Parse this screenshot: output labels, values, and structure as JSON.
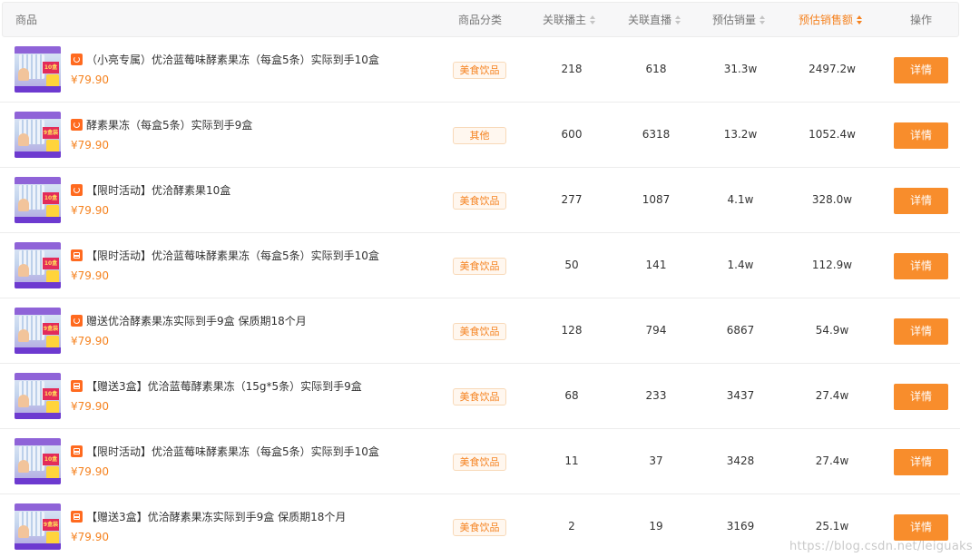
{
  "header": {
    "product": "商品",
    "category": "商品分类",
    "anchors": "关联播主",
    "lives": "关联直播",
    "sales": "预估销量",
    "revenue": "预估销售额",
    "actions": "操作"
  },
  "accent_color": "#f5821f",
  "rows": [
    {
      "icon": "tmall-icon",
      "title": "（小亮专属）优洽蓝莓味酵素果冻（每盒5条）实际到手10盒",
      "price": "¥79.90",
      "category": "美食饮品",
      "anchors": "218",
      "lives": "618",
      "sales": "31.3w",
      "revenue": "2497.2w",
      "action": "详情",
      "thumb_badge": "10盒装"
    },
    {
      "icon": "tmall-icon",
      "title": "酵素果冻（每盒5条）实际到手9盒",
      "price": "¥79.90",
      "category": "其他",
      "anchors": "600",
      "lives": "6318",
      "sales": "13.2w",
      "revenue": "1052.4w",
      "action": "详情",
      "thumb_badge": "9盒装"
    },
    {
      "icon": "tmall-icon",
      "title": "【限时活动】优洽酵素果10盒",
      "price": "¥79.90",
      "category": "美食饮品",
      "anchors": "277",
      "lives": "1087",
      "sales": "4.1w",
      "revenue": "328.0w",
      "action": "详情",
      "thumb_badge": "10盒装"
    },
    {
      "icon": "taobao-bag-icon",
      "title": "【限时活动】优洽蓝莓味酵素果冻（每盒5条）实际到手10盒",
      "price": "¥79.90",
      "category": "美食饮品",
      "anchors": "50",
      "lives": "141",
      "sales": "1.4w",
      "revenue": "112.9w",
      "action": "详情",
      "thumb_badge": "10盒装"
    },
    {
      "icon": "tmall-icon",
      "title": "赠送优洽酵素果冻实际到手9盒 保质期18个月",
      "price": "¥79.90",
      "category": "美食饮品",
      "anchors": "128",
      "lives": "794",
      "sales": "6867",
      "revenue": "54.9w",
      "action": "详情",
      "thumb_badge": "9盒装"
    },
    {
      "icon": "taobao-bag-icon",
      "title": "【赠送3盒】优洽蓝莓酵素果冻（15g*5条）实际到手9盒",
      "price": "¥79.90",
      "category": "美食饮品",
      "anchors": "68",
      "lives": "233",
      "sales": "3437",
      "revenue": "27.4w",
      "action": "详情",
      "thumb_badge": "10盒装"
    },
    {
      "icon": "taobao-bag-icon",
      "title": "【限时活动】优洽蓝莓味酵素果冻（每盒5条）实际到手10盒",
      "price": "¥79.90",
      "category": "美食饮品",
      "anchors": "11",
      "lives": "37",
      "sales": "3428",
      "revenue": "27.4w",
      "action": "详情",
      "thumb_badge": "10盒装"
    },
    {
      "icon": "taobao-bag-icon",
      "title": "【赠送3盒】优洽酵素果冻实际到手9盒 保质期18个月",
      "price": "¥79.90",
      "category": "美食饮品",
      "anchors": "2",
      "lives": "19",
      "sales": "3169",
      "revenue": "25.1w",
      "action": "详情",
      "thumb_badge": "9盒装"
    }
  ],
  "watermark": "https://blog.csdn.net/leiguaks"
}
